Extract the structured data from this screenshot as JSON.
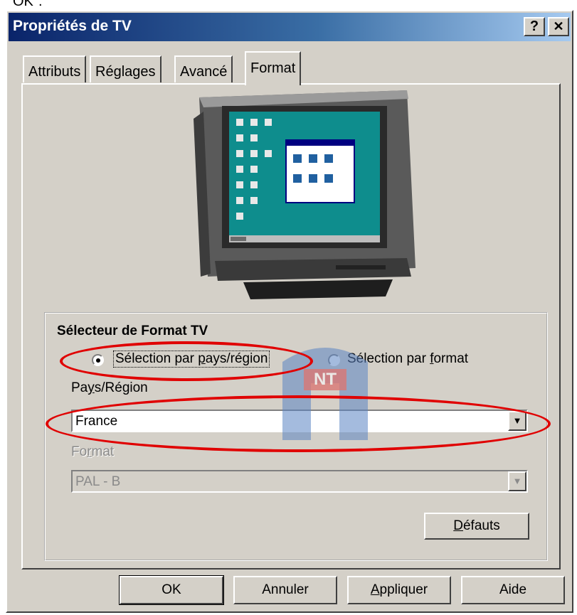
{
  "cut_text": "OK\".",
  "window": {
    "title": "Propriétés de TV",
    "help_btn": "?",
    "close_btn": "✕"
  },
  "tabs": [
    {
      "label": "Attributs"
    },
    {
      "label": "Réglages"
    },
    {
      "label": "Avancé"
    },
    {
      "label": "Format",
      "active": true
    }
  ],
  "group": {
    "title": "Sélecteur de Format TV",
    "radio_country": "Sélection par pays/région",
    "radio_format": "Sélection par format",
    "selected": "country",
    "country_label": "Pays/Région",
    "country_value": "France",
    "format_label": "Format",
    "format_value": "PAL - B",
    "defaults_btn": "Défauts"
  },
  "buttons": {
    "ok": "OK",
    "cancel": "Annuler",
    "apply": "Appliquer",
    "help": "Aide"
  },
  "watermark": "NT",
  "colors": {
    "annotation": "#e00000",
    "titlebar_start": "#0a246a",
    "titlebar_end": "#a6caf0",
    "face": "#d4d0c8"
  }
}
